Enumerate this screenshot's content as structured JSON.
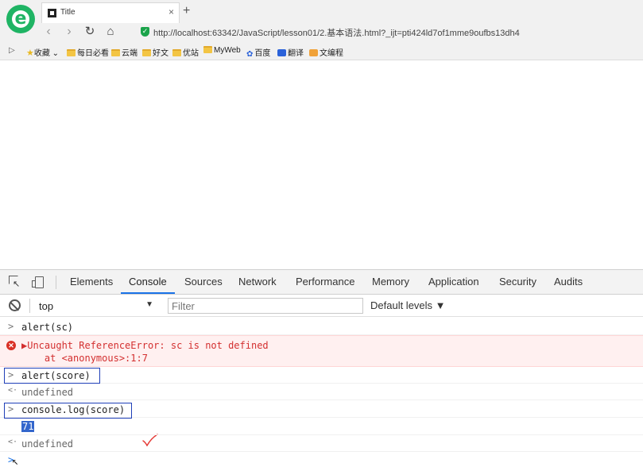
{
  "browser": {
    "tab": {
      "title": "Title",
      "close": "×"
    },
    "new_tab": "+",
    "nav": {
      "back": "‹",
      "forward": "›",
      "reload": "↻",
      "home": "⌂"
    },
    "url": "http://localhost:63342/JavaScript/lesson01/2.基本语法.html?_ijt=pti424ld7of1mme9oufbs13dh4",
    "bookmarks": {
      "toggle": "▷",
      "items": [
        "收藏",
        "每日必看",
        "云端",
        "好文",
        "优站",
        "MyWeb",
        "百度",
        "翻译",
        "文编程"
      ]
    }
  },
  "devtools": {
    "tabs": [
      "Elements",
      "Console",
      "Sources",
      "Network",
      "Performance",
      "Memory",
      "Application",
      "Security",
      "Audits"
    ],
    "active_tab": "Console",
    "context": "top",
    "filter_placeholder": "Filter",
    "levels": "Default levels ▼"
  },
  "console": {
    "lines": [
      {
        "prefix": ">",
        "text": "alert(sc)"
      },
      {
        "prefix": "",
        "text": "▶Uncaught ReferenceError: sc is not defined"
      },
      {
        "prefix": "",
        "text": "    at <anonymous>:1:7"
      },
      {
        "prefix": ">",
        "text": "alert(score)"
      },
      {
        "prefix": "<·",
        "text": "undefined"
      },
      {
        "prefix": ">",
        "text": "console.log(score)"
      },
      {
        "prefix": "",
        "text": "71"
      },
      {
        "prefix": "<·",
        "text": "undefined"
      },
      {
        "prefix": ">",
        "text": ""
      }
    ]
  },
  "colors": {
    "accent": "#1a73e8",
    "error": "#d32f2f",
    "annotation_box": "#1f3fb8",
    "checkmark": "#e53935"
  }
}
